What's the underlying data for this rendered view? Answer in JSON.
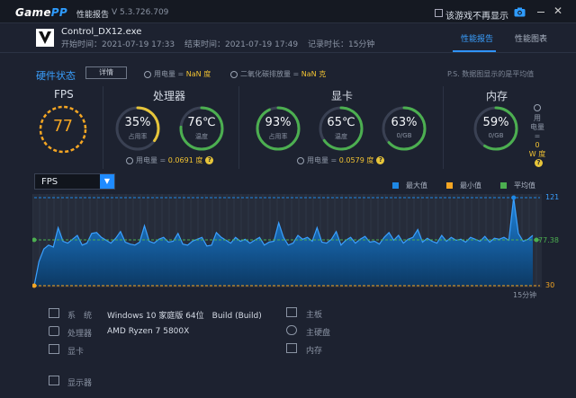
{
  "titlebar": {
    "logo_a": "Game",
    "logo_b": "PP",
    "title": "性能报告",
    "version": "V 5.3.726.709",
    "noshow_label": "该游戏不再显示",
    "icons": [
      "camera-icon",
      "minimize-icon",
      "close-icon"
    ]
  },
  "app": {
    "name": "Control_DX12.exe",
    "start": "开始时间：2021-07-19 17:33",
    "end": "结束时间：2021-07-19 17:49",
    "duration": "记录时长：15分钟"
  },
  "tabs": [
    {
      "label": "性能报告",
      "active": true
    },
    {
      "label": "性能图表",
      "active": false
    }
  ],
  "hardware": {
    "title": "硬件状态",
    "detail_button": "详情",
    "power_label": "用电量 = ",
    "power_value": "NaN 度",
    "co2_label": "二氧化碳排放量 = ",
    "co2_value": "NaN 克",
    "ps_note": "P.S. 数据图显示的是平均值"
  },
  "metrics": {
    "fps": {
      "title": "FPS",
      "value": "77"
    },
    "cpu": {
      "title": "处理器",
      "usage": {
        "value": "35%",
        "label": "占用率",
        "level": 0.35
      },
      "temp": {
        "value": "76℃",
        "label": "温度",
        "level": 0.76
      },
      "power_label": "用电量 = ",
      "power_value": "0.0691 度"
    },
    "gpu": {
      "title": "显卡",
      "usage": {
        "value": "93%",
        "label": "占用率",
        "level": 0.93
      },
      "temp": {
        "value": "65℃",
        "label": "温度",
        "level": 0.65
      },
      "mem": {
        "value": "63%",
        "label": "0/GB",
        "level": 0.63
      },
      "power_label": "用电量 = ",
      "power_value": "0.0579 度"
    },
    "memory": {
      "title": "内存",
      "usage": {
        "value": "59%",
        "label": "0/GB",
        "level": 0.59
      },
      "side_line1": "用",
      "side_line2": "电",
      "side_line3": "量",
      "side_line4": "=",
      "side_line5": "0",
      "side_line6": "W 度"
    }
  },
  "graph": {
    "selector": "FPS",
    "legend": [
      {
        "label": "最大值",
        "color": "#1e88e5"
      },
      {
        "label": "最小值",
        "color": "#f5a623"
      },
      {
        "label": "平均值",
        "color": "#4caf50"
      }
    ],
    "max_label": "121",
    "avg_label": "77.38",
    "min_label": "30",
    "time_label": "15分钟"
  },
  "chart_data": {
    "type": "area",
    "title": "",
    "xlabel": "",
    "ylabel": "",
    "x_end_label": "15分钟",
    "ylim": [
      30,
      121
    ],
    "max": 121,
    "min": 30,
    "avg": 77.38,
    "values": [
      30,
      55,
      68,
      72,
      70,
      90,
      76,
      74,
      78,
      82,
      72,
      74,
      84,
      85,
      80,
      77,
      74,
      79,
      86,
      75,
      73,
      72,
      75,
      92,
      76,
      74,
      78,
      80,
      75,
      76,
      84,
      73,
      72,
      76,
      78,
      80,
      71,
      72,
      85,
      80,
      77,
      74,
      80,
      76,
      78,
      74,
      77,
      80,
      72,
      75,
      76,
      95,
      80,
      72,
      74,
      82,
      78,
      80,
      76,
      90,
      75,
      74,
      78,
      86,
      72,
      77,
      80,
      74,
      78,
      81,
      75,
      76,
      73,
      80,
      85,
      77,
      82,
      74,
      78,
      80,
      88,
      75,
      79,
      76,
      74,
      82,
      76,
      80,
      77,
      78,
      75,
      80,
      78,
      76,
      81,
      75,
      79,
      78,
      80,
      77,
      121,
      84,
      76,
      78,
      82
    ]
  },
  "system": {
    "os_key": "系　统",
    "os_value": "Windows 10 家庭版 64位　Build (Build)",
    "cpu_key": "处理器",
    "cpu_value": "AMD Ryzen 7 5800X",
    "gpu_key": "显卡",
    "monitor_key": "显示器",
    "board_key": "主板",
    "disk_key": "主硬盘",
    "ram_key": "内存"
  }
}
